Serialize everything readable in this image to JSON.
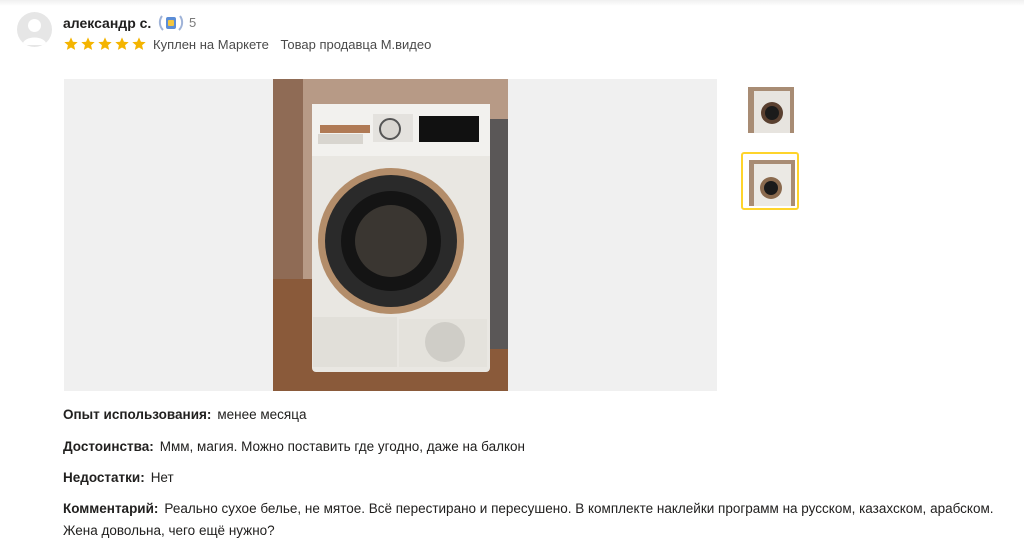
{
  "review": {
    "author": "александр с.",
    "reviews_count": "5",
    "rating": 5,
    "tags": [
      "Куплен на Маркете",
      "Товар продавца М.видео"
    ],
    "experience_label": "Опыт использования:",
    "experience_value": "менее месяца",
    "pros_label": "Достоинства:",
    "pros_value": "Ммм, магия. Можно поставить где угодно, даже на балкон",
    "cons_label": "Недостатки:",
    "cons_value": "Нет",
    "comment_label": "Комментарий:",
    "comment_value": "Реально сухое белье, не мятое. Всё перестирано и пересушено. В комплекте наклейки программ на русском, казахском, арабском. Жена довольна, чего ещё нужно?"
  },
  "icons": {
    "avatar": "user-avatar-icon",
    "badge": "laurel-badge-icon",
    "star": "star-icon"
  },
  "colors": {
    "star": "#f4b400",
    "selected_thumb_border": "#fed42b",
    "photo_background": "#f0f0f0"
  }
}
